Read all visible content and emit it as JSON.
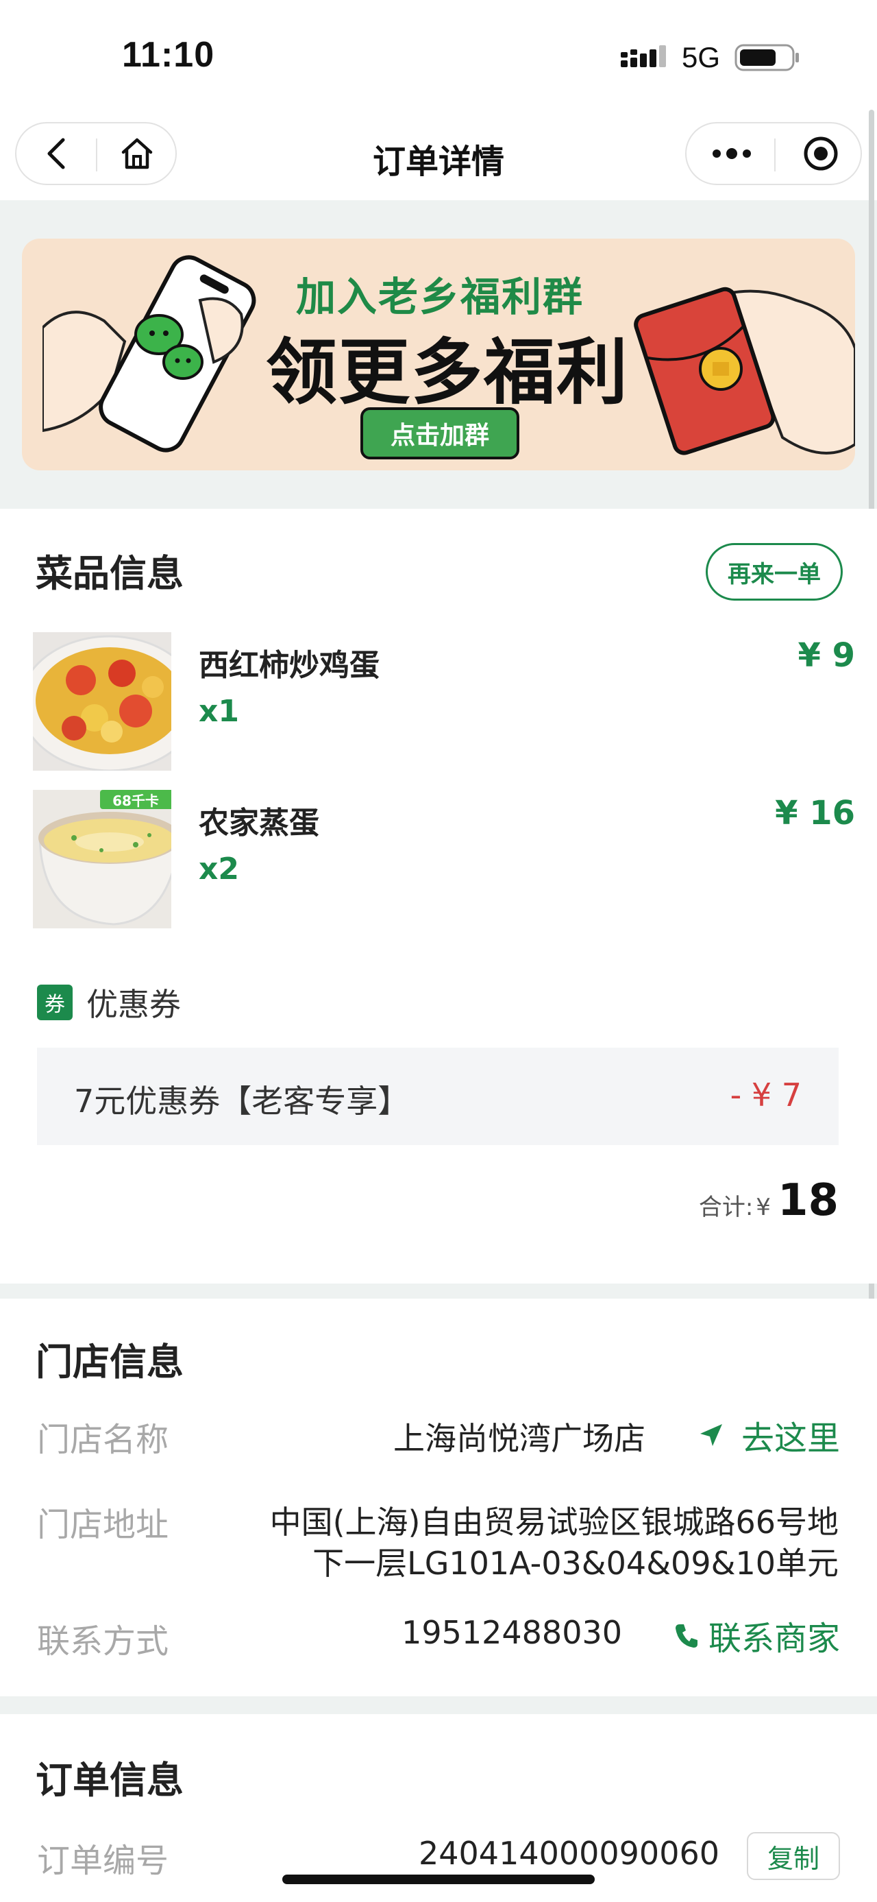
{
  "status_bar": {
    "time": "11:10",
    "network": "5G"
  },
  "nav": {
    "title": "订单详情"
  },
  "banner": {
    "title": "加入老乡福利群",
    "headline": "领更多福利",
    "button": "点击加群"
  },
  "dishes_section": {
    "title": "菜品信息",
    "reorder_button": "再来一单",
    "items": [
      {
        "name": "西红柿炒鸡蛋",
        "qty": "x1",
        "price": "¥ 9"
      },
      {
        "name": "农家蒸蛋",
        "qty": "x2",
        "price": "¥ 16",
        "badge": "68千卡"
      }
    ],
    "coupon": {
      "tag": "券",
      "label": "优惠券",
      "name": "7元优惠券【老客专享】",
      "discount": "- ¥ 7"
    },
    "total": {
      "label": "合计:",
      "currency": "¥",
      "amount": "18"
    }
  },
  "store_section": {
    "title": "门店信息",
    "name_label": "门店名称",
    "name_value": "上海尚悦湾广场店",
    "navigate_link": "去这里",
    "address_label": "门店地址",
    "address_line1": "中国(上海)自由贸易试验区银城路66号地",
    "address_line2": "下一层LG101A-03&04&09&10单元",
    "contact_label": "联系方式",
    "contact_value": "19512488030",
    "contact_link": "联系商家"
  },
  "order_section": {
    "title": "订单信息",
    "order_no_label": "订单编号",
    "order_no_value": "240414000090060",
    "copy_button": "复制"
  },
  "colors": {
    "accent": "#1c8a4c",
    "discount": "#d64040",
    "page_bg": "#eef2f1"
  }
}
